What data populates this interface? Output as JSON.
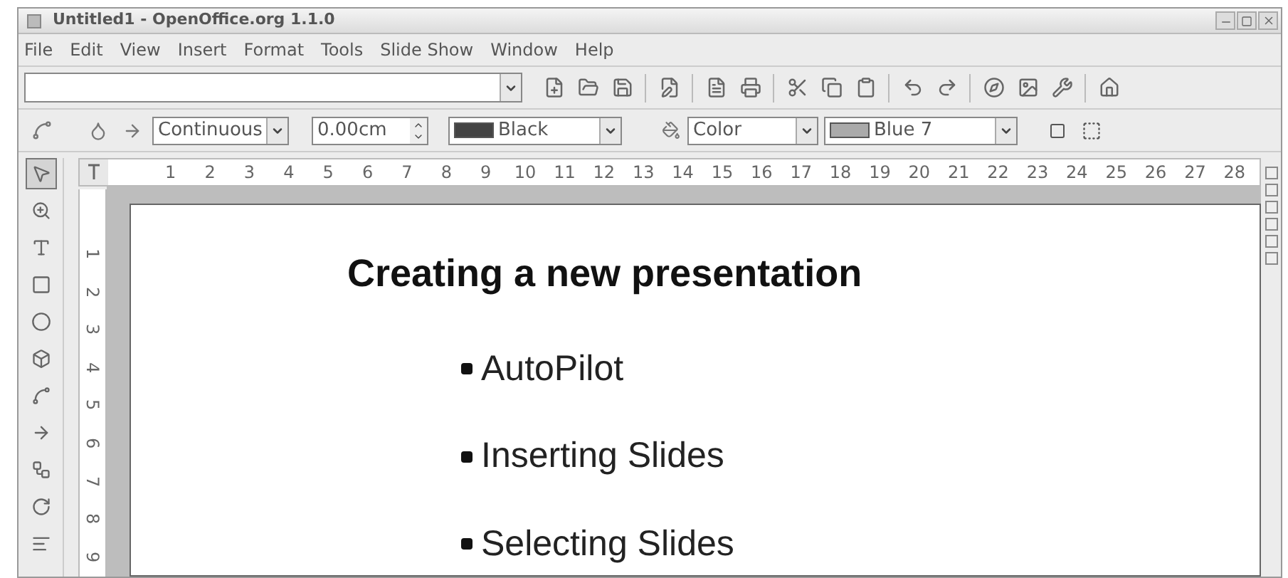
{
  "window": {
    "title": "Untitled1 - OpenOffice.org 1.1.0"
  },
  "menu": [
    "File",
    "Edit",
    "View",
    "Insert",
    "Format",
    "Tools",
    "Slide Show",
    "Window",
    "Help"
  ],
  "line_bar": {
    "line_style": "Continuous",
    "line_width": "0.00cm",
    "line_color": "Black",
    "area_style": "Color",
    "area_fill": "Blue 7"
  },
  "tools": [
    {
      "selected": true
    },
    {
      "selected": false
    },
    {
      "selected": false
    },
    {
      "selected": false
    },
    {
      "selected": false
    },
    {
      "selected": false
    },
    {
      "selected": false
    },
    {
      "selected": false
    },
    {
      "selected": false
    },
    {
      "selected": false
    },
    {
      "selected": false
    }
  ],
  "horizontal_ruler": [
    "1",
    "2",
    "3",
    "4",
    "5",
    "6",
    "7",
    "8",
    "9",
    "10",
    "11",
    "12",
    "13",
    "14",
    "15",
    "16",
    "17",
    "18",
    "19",
    "20",
    "21",
    "22",
    "23",
    "24",
    "25",
    "26",
    "27",
    "28"
  ],
  "vertical_ruler": [
    "1",
    "2",
    "3",
    "4",
    "5",
    "6",
    "7",
    "8",
    "9"
  ],
  "slide": {
    "title": "Creating a new presentation",
    "bullets": [
      "AutoPilot",
      "Inserting Slides",
      "Selecting Slides"
    ]
  }
}
